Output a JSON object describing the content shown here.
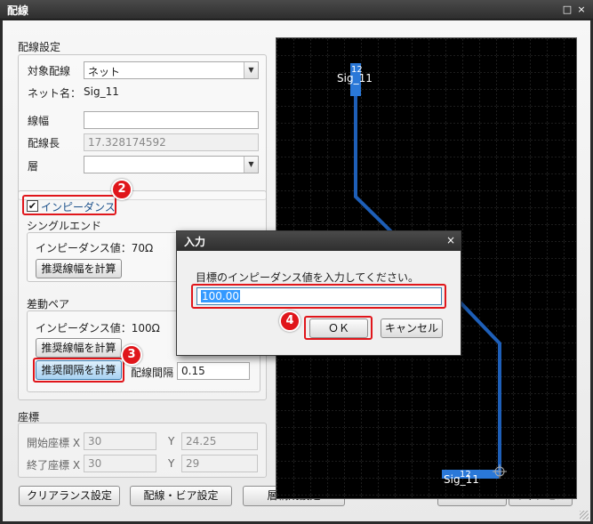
{
  "window": {
    "title": "配線",
    "buttons": {
      "restore_icon": "□",
      "close_icon": "×"
    }
  },
  "routing_settings": {
    "group_label": "配線設定",
    "target_label": "対象配線",
    "target_value": "ネット",
    "netname_label": "ネット名：",
    "netname_value": "Sig_11",
    "width_label": "線幅",
    "width_value": "",
    "length_label": "配線長",
    "length_value": "17.328174592",
    "layer_label": "層",
    "layer_value": ""
  },
  "impedance": {
    "checkbox_label": "インピーダンス",
    "checked": true,
    "single_label": "シングルエンド",
    "single_value_text": "インピーダンス値：70Ω",
    "single_calc_width": "推奨線幅を計算",
    "diff_label": "差動ペア",
    "diff_value_text": "インピーダンス値：100Ω",
    "diff_calc_width": "推奨線幅を計算",
    "diff_calc_gap": "推奨間隔を計算",
    "gap_label": "配線間隔",
    "gap_value": "0.15"
  },
  "coords": {
    "group_label": "座標",
    "start_label": "開始座標 X",
    "start_x": "30",
    "start_y_label": "Y",
    "start_y": "24.25",
    "end_label": "終了座標 X",
    "end_x": "30",
    "end_y_label": "Y",
    "end_y": "29"
  },
  "footer": {
    "clearance": "クリアランス設定",
    "wire_via": "配線・ビア設定",
    "layers": "層構成設定",
    "ok": "ＯＫ",
    "cancel": "キャンセル"
  },
  "canvas": {
    "pad_top_name": "Sig_11",
    "pad_top_num": "12",
    "pad_bottom_name": "Sig_11",
    "pad_bottom_num": "12",
    "colors": {
      "trace": "#1e5fb8",
      "grid": "#3a3a3a",
      "pad": "#2a78d8"
    }
  },
  "input_dialog": {
    "title": "入力",
    "close_icon": "×",
    "prompt": "目標のインピーダンス値を入力してください。",
    "value": "100.00",
    "ok": "ＯＫ",
    "cancel": "キャンセル"
  },
  "annotations": {
    "step2": "2",
    "step3": "3",
    "step4": "4",
    "color": "#e0161b"
  }
}
